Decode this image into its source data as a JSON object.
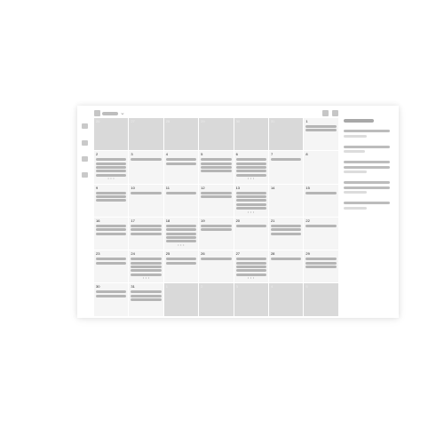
{
  "calendar": {
    "view": "month",
    "weeks": [
      [
        {
          "day": "26",
          "other": true,
          "events": 0
        },
        {
          "day": "27",
          "other": true,
          "events": 0
        },
        {
          "day": "28",
          "other": true,
          "events": 0
        },
        {
          "day": "29",
          "other": true,
          "events": 0
        },
        {
          "day": "30",
          "other": true,
          "events": 0
        },
        {
          "day": "31",
          "other": true,
          "events": 0
        },
        {
          "day": "1",
          "other": false,
          "events": 2
        }
      ],
      [
        {
          "day": "2",
          "other": false,
          "events": 5,
          "more": true
        },
        {
          "day": "3",
          "other": false,
          "events": 1
        },
        {
          "day": "4",
          "other": false,
          "events": 2
        },
        {
          "day": "5",
          "other": false,
          "events": 4
        },
        {
          "day": "6",
          "other": false,
          "events": 5,
          "more": true
        },
        {
          "day": "7",
          "other": false,
          "events": 1
        },
        {
          "day": "8",
          "other": false,
          "events": 0
        }
      ],
      [
        {
          "day": "9",
          "other": false,
          "events": 3
        },
        {
          "day": "10",
          "other": false,
          "events": 1
        },
        {
          "day": "11",
          "other": false,
          "events": 1
        },
        {
          "day": "12",
          "other": false,
          "events": 2
        },
        {
          "day": "13",
          "other": false,
          "events": 5,
          "more": true
        },
        {
          "day": "14",
          "other": false,
          "events": 0
        },
        {
          "day": "15",
          "other": false,
          "events": 1
        }
      ],
      [
        {
          "day": "16",
          "other": false,
          "events": 3
        },
        {
          "day": "17",
          "other": false,
          "events": 3
        },
        {
          "day": "18",
          "other": false,
          "events": 5,
          "more": true
        },
        {
          "day": "19",
          "other": false,
          "events": 2
        },
        {
          "day": "20",
          "other": false,
          "events": 1
        },
        {
          "day": "21",
          "other": false,
          "events": 3
        },
        {
          "day": "22",
          "other": false,
          "events": 1
        }
      ],
      [
        {
          "day": "23",
          "other": false,
          "events": 2
        },
        {
          "day": "24",
          "other": false,
          "events": 5,
          "more": true
        },
        {
          "day": "25",
          "other": false,
          "events": 2
        },
        {
          "day": "26",
          "other": false,
          "events": 1
        },
        {
          "day": "27",
          "other": false,
          "events": 5,
          "more": true
        },
        {
          "day": "28",
          "other": false,
          "events": 1
        },
        {
          "day": "29",
          "other": false,
          "events": 3
        }
      ],
      [
        {
          "day": "30",
          "other": false,
          "events": 2
        },
        {
          "day": "31",
          "other": false,
          "events": 3
        },
        {
          "day": "1",
          "other": true,
          "events": 0
        },
        {
          "day": "2",
          "other": true,
          "events": 0
        },
        {
          "day": "3",
          "other": true,
          "events": 0
        },
        {
          "day": "4",
          "other": true,
          "events": 0
        },
        {
          "day": "5",
          "other": true,
          "events": 0
        }
      ]
    ],
    "more_indicator": "• • •"
  },
  "toolbar": {
    "chevron": "⌄"
  },
  "colors": {
    "cell": "#f5f5f5",
    "other_month_cell": "#d9d9d9",
    "event_bar": "#b5b5b5"
  }
}
